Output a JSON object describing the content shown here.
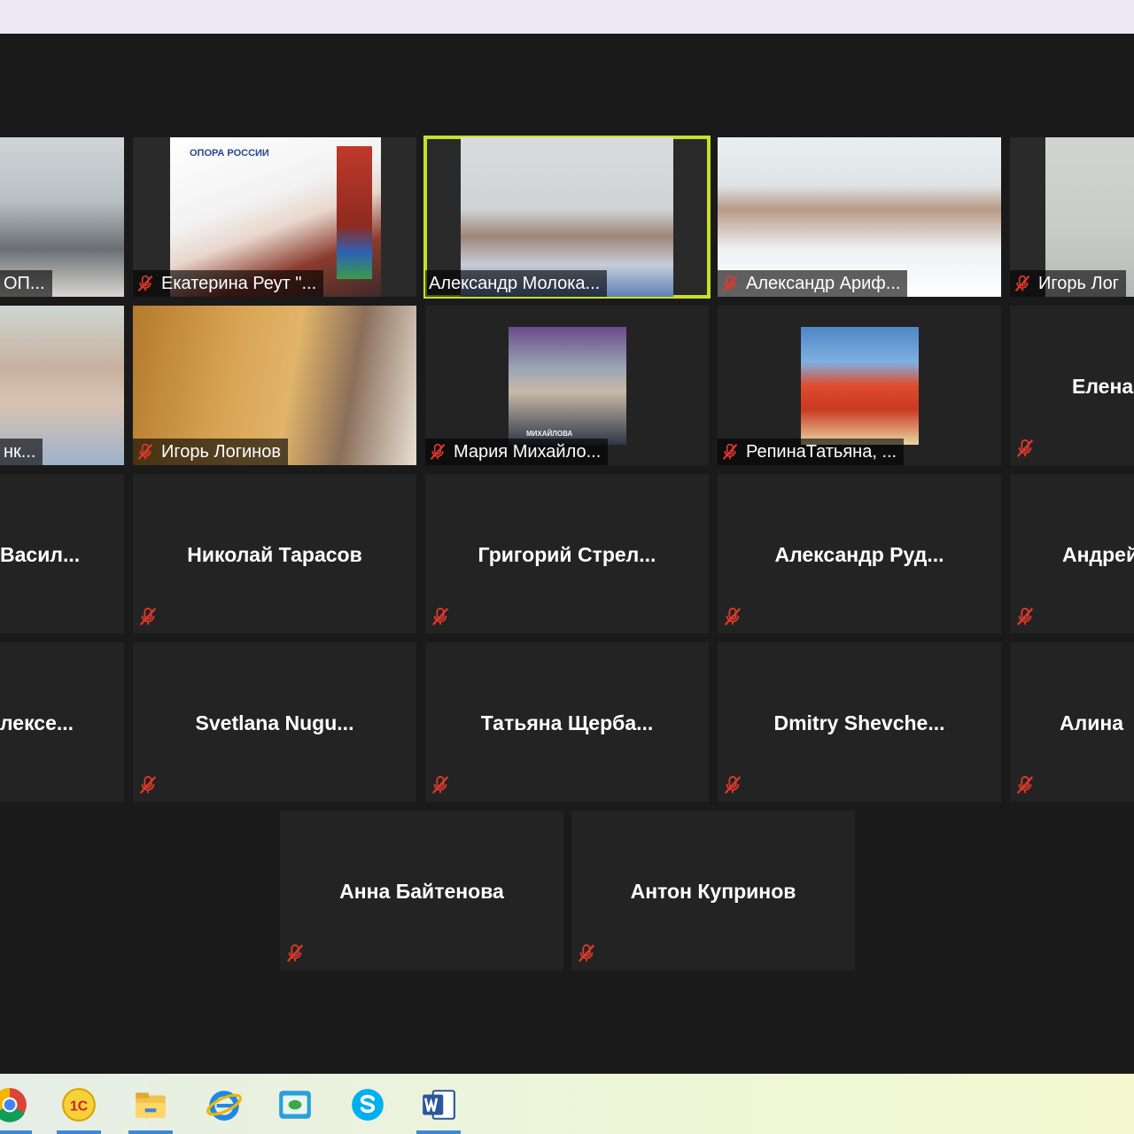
{
  "video_tiles": {
    "t0": "ОП...",
    "t1": "Екатерина Реут \"...",
    "t1_banner": "ОПОРА РОССИИ",
    "t2": "Александр Молока...",
    "t3": "Александр Ариф...",
    "t4": "Игорь Лог",
    "t5": "нк...",
    "t6": "Игорь Логинов",
    "t7": "Мария Михайло...",
    "t7_badge": "МИХАЙЛОВА",
    "t8": "РепинаТатьяна, ..."
  },
  "name_tiles": {
    "n1": "Елена",
    "r3_0": "Васил...",
    "r3_1": "Николай Тарасов",
    "r3_2": "Григорий  Стрел...",
    "r3_3": "Александр  Руд...",
    "r3_4": "Андрей",
    "r4_0": "лексе...",
    "r4_1": "Svetlana  Nugu...",
    "r4_2": "Татьяна  Щерба...",
    "r4_3": "Dmitry  Shevche...",
    "r4_4": "Алина",
    "r5_0": "Анна Байтенова",
    "r5_1": "Антон Купринов"
  },
  "colors": {
    "active_speaker_border": "#c8e024",
    "muted_mic": "#e0392b",
    "tile_background": "#232323",
    "taskbar_indicator": "#3a8ad8"
  },
  "taskbar": {
    "apps": [
      "chrome-icon",
      "1c-icon",
      "file-explorer-icon",
      "internet-explorer-icon",
      "app-icon",
      "skype-icon",
      "word-icon"
    ],
    "app_labels": {
      "one_c": "1С"
    }
  }
}
